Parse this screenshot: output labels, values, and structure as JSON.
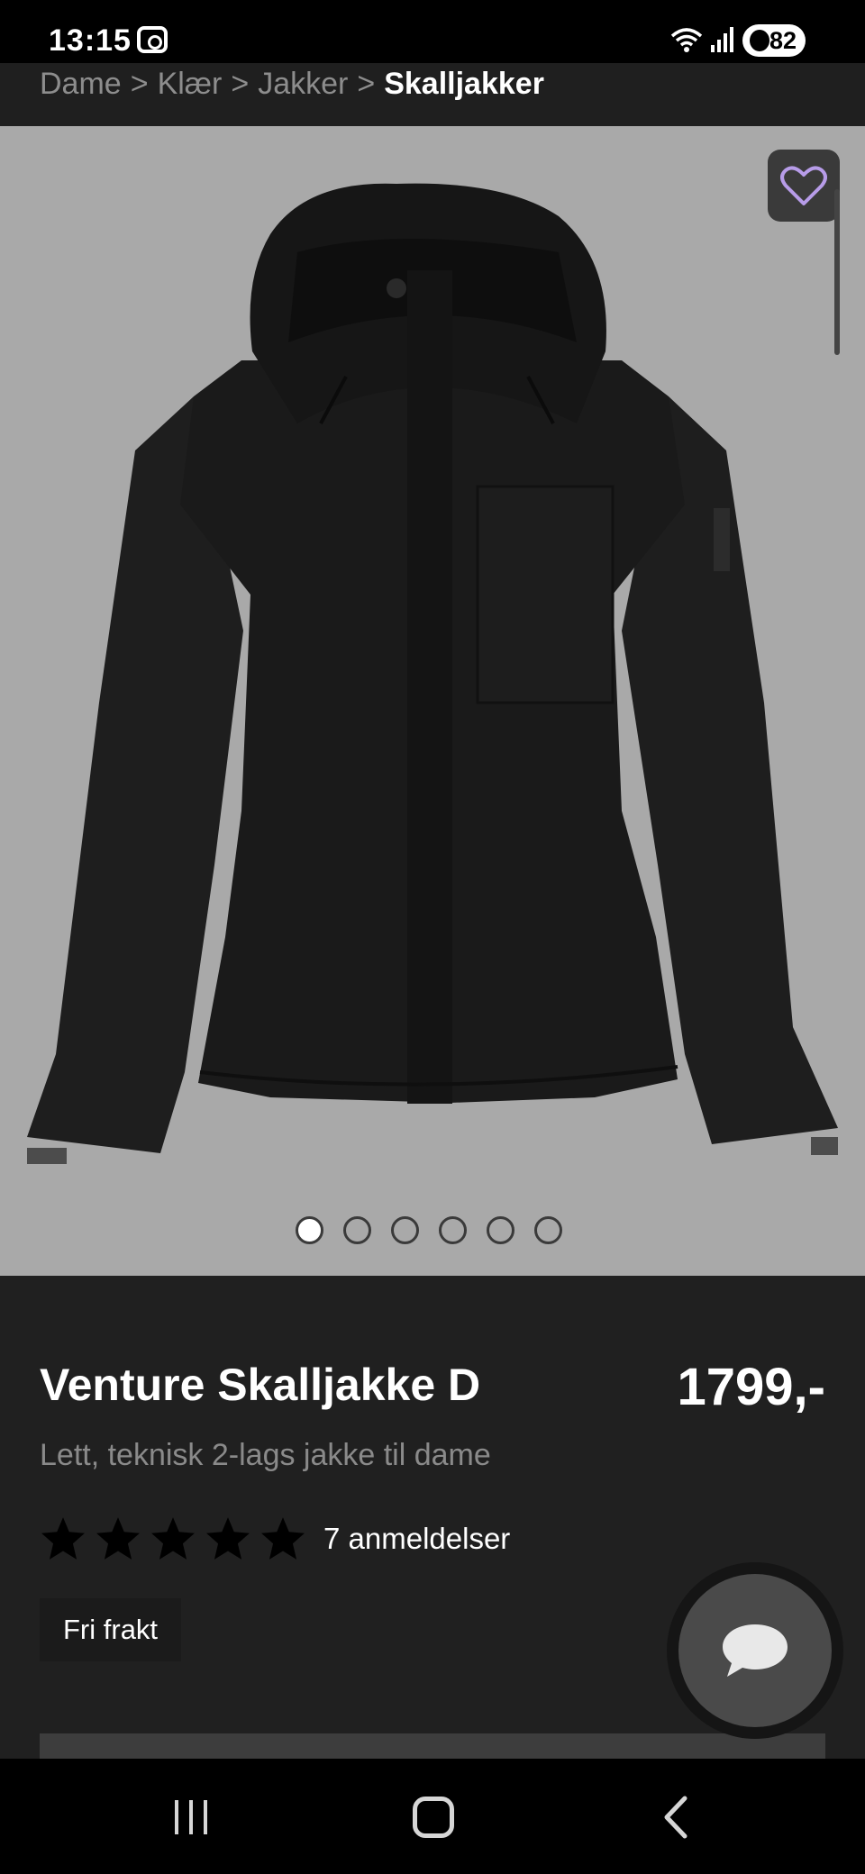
{
  "status_bar": {
    "time": "13:15",
    "battery": "82"
  },
  "breadcrumb": {
    "items": [
      "Dame",
      "Klær",
      "Jakker"
    ],
    "separator": ">",
    "current": "Skalljakker"
  },
  "gallery": {
    "image_count": 6,
    "active_index": 0,
    "image_description_icon": "jacket-image",
    "background_color": "#a9a9a9"
  },
  "product": {
    "title": "Venture Skalljakke D",
    "price": "1799,-",
    "subtitle": "Lett, teknisk 2-lags jakke til dame",
    "rating": 5,
    "rating_max": 5,
    "review_count_label": "7 anmeldelser",
    "badge": "Fri frakt"
  },
  "colors": {
    "background": "#202020",
    "wishlist_icon": "#b79ce8"
  }
}
